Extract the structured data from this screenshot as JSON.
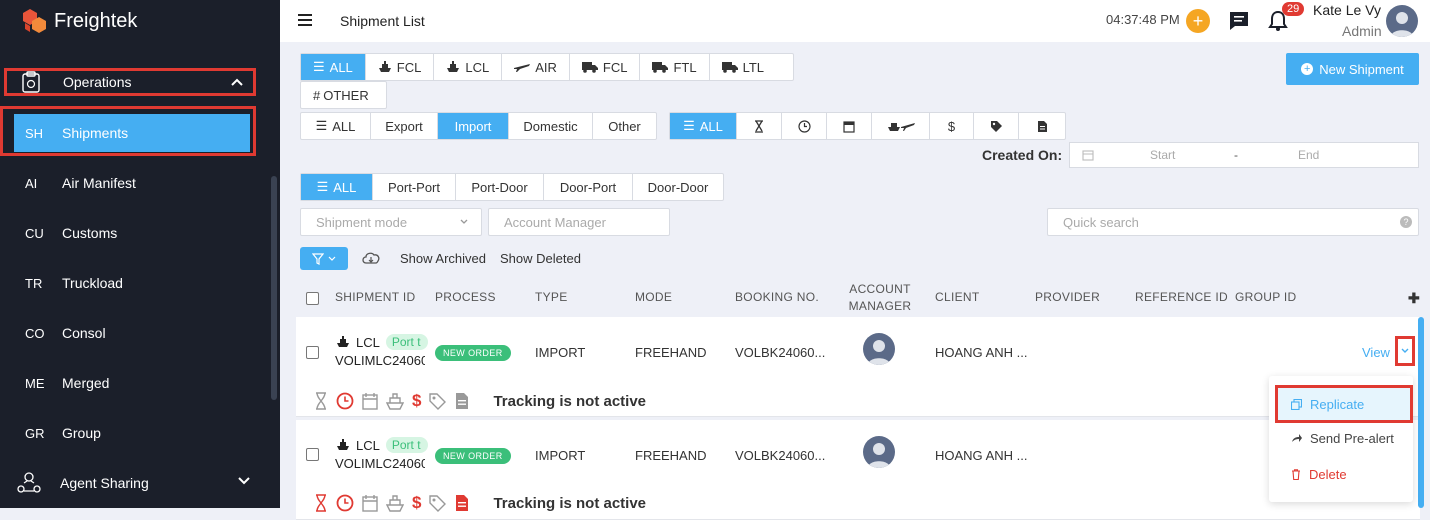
{
  "brand": {
    "name": "Freightek"
  },
  "sidebar": {
    "operations_label": "Operations",
    "items": [
      {
        "abbr": "SH",
        "label": "Shipments"
      },
      {
        "abbr": "AI",
        "label": "Air Manifest"
      },
      {
        "abbr": "CU",
        "label": "Customs"
      },
      {
        "abbr": "TR",
        "label": "Truckload"
      },
      {
        "abbr": "CO",
        "label": "Consol"
      },
      {
        "abbr": "ME",
        "label": "Merged"
      },
      {
        "abbr": "GR",
        "label": "Group"
      }
    ],
    "agent_sharing_label": "Agent Sharing"
  },
  "topbar": {
    "title": "Shipment List",
    "time": "04:37:48 PM",
    "notification_count": "29",
    "user_name": "Kate Le Vy",
    "user_role": "Admin"
  },
  "filters": {
    "mode_tabs": [
      "ALL",
      "FCL",
      "LCL",
      "AIR",
      "FCL",
      "FTL",
      "LTL",
      "OTHER"
    ],
    "direction_tabs": [
      "ALL",
      "Export",
      "Import",
      "Domestic",
      "Other"
    ],
    "status_tabs": [
      "ALL"
    ],
    "service_tabs": [
      "ALL",
      "Port-Port",
      "Port-Door",
      "Door-Port",
      "Door-Door"
    ],
    "created_on_label": "Created On:",
    "date_start_placeholder": "Start",
    "date_separator": "-",
    "date_end_placeholder": "End",
    "shipment_mode_placeholder": "Shipment mode",
    "account_manager_placeholder": "Account Manager",
    "quick_search_placeholder": "Quick search",
    "show_archived": "Show Archived",
    "show_deleted": "Show Deleted",
    "new_shipment_label": "New Shipment"
  },
  "table": {
    "columns": [
      "SHIPMENT ID",
      "PROCESS",
      "TYPE",
      "MODE",
      "BOOKING NO.",
      "ACCOUNT",
      "MANAGER",
      "CLIENT",
      "PROVIDER",
      "REFERENCE ID",
      "GROUP ID"
    ],
    "rows": [
      {
        "mode": "LCL",
        "port_tag": "Port t",
        "shipment_id": "VOLIMLC24060",
        "process": "NEW ORDER",
        "type": "IMPORT",
        "freight_mode": "FREEHAND",
        "booking": "VOLBK24060...",
        "client": "HOANG ANH ...",
        "view": "View",
        "tracking": "Tracking is not active"
      },
      {
        "mode": "LCL",
        "port_tag": "Port t",
        "shipment_id": "VOLIMLC24060",
        "process": "NEW ORDER",
        "type": "IMPORT",
        "freight_mode": "FREEHAND",
        "booking": "VOLBK24060...",
        "client": "HOANG ANH ...",
        "view": "View",
        "tracking": "Tracking is not active"
      }
    ]
  },
  "row_menu": {
    "replicate": "Replicate",
    "send_prealert": "Send Pre-alert",
    "delete": "Delete"
  },
  "colors": {
    "accent": "#45aef2",
    "sidebar_bg": "#1b1f2a",
    "highlight_border": "#e03a32",
    "success": "#3bbf7a",
    "danger": "#e03a32",
    "orange": "#f5a623"
  }
}
